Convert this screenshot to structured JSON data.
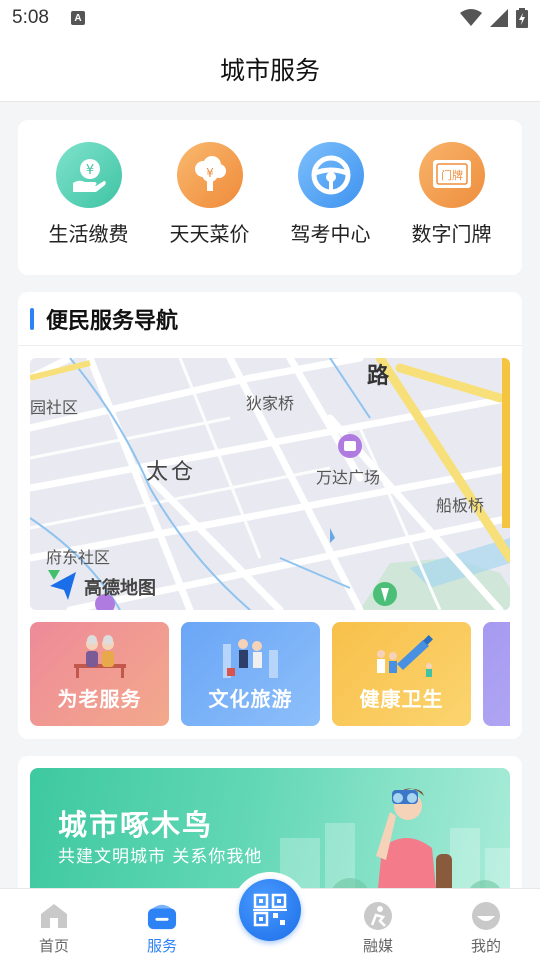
{
  "status_bar": {
    "time": "5:08",
    "notification_glyph": "A"
  },
  "header": {
    "title": "城市服务"
  },
  "quick_services": [
    {
      "label": "生活缴费",
      "icon": "hand-coin-icon",
      "color": "#4fd0b0"
    },
    {
      "label": "天天菜价",
      "icon": "vegetable-price-icon",
      "color": "#f29a4b"
    },
    {
      "label": "驾考中心",
      "icon": "steering-wheel-icon",
      "color": "#4ea6f5"
    },
    {
      "label": "数字门牌",
      "icon": "door-plate-icon",
      "color": "#f2994a"
    }
  ],
  "nav_section": {
    "title": "便民服务导航",
    "map": {
      "labels": {
        "community_left": "园社区",
        "road": "路",
        "dijiaqiao": "狄家桥",
        "taicang": "太仓",
        "wanda": "万达广场",
        "chuanbanqiao": "船板桥",
        "fudong": "府东社区",
        "amap": "高德地图"
      }
    },
    "categories": [
      {
        "label": "为老服务",
        "color_from": "#ee8a98",
        "color_to": "#f3a98c"
      },
      {
        "label": "文化旅游",
        "color_from": "#6aa6f6",
        "color_to": "#8dbffa"
      },
      {
        "label": "健康卫生",
        "color_from": "#f8c04a",
        "color_to": "#fbd46f"
      },
      {
        "label": "",
        "color_from": "#a59af0",
        "color_to": "#b8aef6"
      }
    ]
  },
  "banner": {
    "title": "城市啄木鸟",
    "subtitle": "共建文明城市   关系你我他"
  },
  "tabbar": {
    "items": [
      {
        "label": "首页",
        "active": false
      },
      {
        "label": "服务",
        "active": true
      },
      {
        "label": "融媒",
        "active": false
      },
      {
        "label": "我的",
        "active": false
      }
    ],
    "accent": "#2d82f5"
  }
}
